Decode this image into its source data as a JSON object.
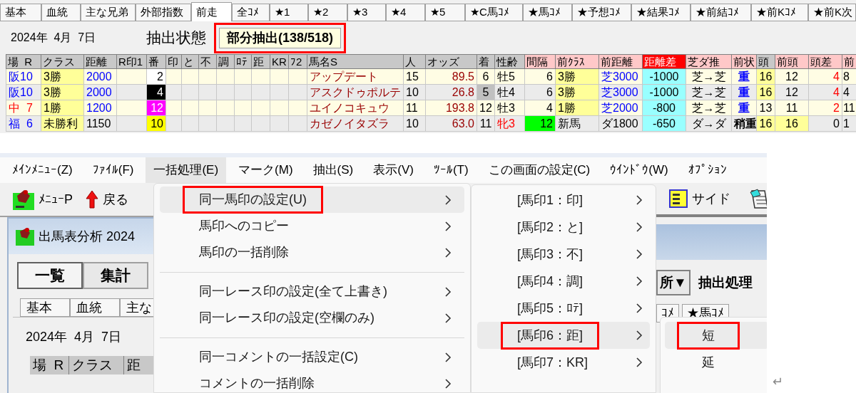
{
  "top_panel": {
    "tabs": [
      {
        "label": "基本",
        "selected": false
      },
      {
        "label": "血統",
        "selected": false
      },
      {
        "label": "主な兄弟",
        "selected": false
      },
      {
        "label": "外部指数",
        "selected": false
      },
      {
        "label": "前走",
        "selected": true
      },
      {
        "label": "全ｺﾒ",
        "selected": false
      },
      {
        "label": "★1",
        "selected": false
      },
      {
        "label": "★2",
        "selected": false
      },
      {
        "label": "★3",
        "selected": false
      },
      {
        "label": "★4",
        "selected": false
      },
      {
        "label": "★5",
        "selected": false
      },
      {
        "label": "★C馬ｺﾒ",
        "selected": false
      },
      {
        "label": "★馬ｺﾒ",
        "selected": false
      },
      {
        "label": "★予想ｺﾒ",
        "selected": false
      },
      {
        "label": "★結果ｺﾒ",
        "selected": false
      },
      {
        "label": "★前結ｺﾒ",
        "selected": false
      },
      {
        "label": "★前Kｺﾒ",
        "selected": false
      },
      {
        "label": "★前K次",
        "selected": false
      }
    ],
    "date": "2024年  4月  7日",
    "extraction_label": "抽出状態",
    "extraction_status": {
      "text": "部分抽出(138/518)",
      "boxed": true
    },
    "table": {
      "columns": [
        {
          "label": "場  R",
          "kind": "plain"
        },
        {
          "label": "クラス",
          "kind": "plain"
        },
        {
          "label": "距離",
          "kind": "plain"
        },
        {
          "label": "R印1",
          "kind": "plain"
        },
        {
          "label": "番",
          "kind": "plain"
        },
        {
          "label": "印",
          "kind": "plain"
        },
        {
          "label": "と",
          "kind": "plain"
        },
        {
          "label": "不",
          "kind": "plain"
        },
        {
          "label": "調",
          "kind": "plain"
        },
        {
          "label": "ﾛﾃ",
          "kind": "plain"
        },
        {
          "label": "距",
          "kind": "plain"
        },
        {
          "label": "KR",
          "kind": "plain"
        },
        {
          "label": "ﾌ2",
          "kind": "plain"
        },
        {
          "label": "馬名S",
          "kind": "plain"
        },
        {
          "label": "人",
          "kind": "plain"
        },
        {
          "label": "オッズ",
          "kind": "plain"
        },
        {
          "label": "着",
          "kind": "plain"
        },
        {
          "label": "性齢",
          "kind": "plain"
        },
        {
          "label": "間隔",
          "kind": "previous"
        },
        {
          "label": "前ｸﾗｽ",
          "kind": "previous"
        },
        {
          "label": "前距離",
          "kind": "previous"
        },
        {
          "label": "距離差",
          "kind": "key"
        },
        {
          "label": "芝ダ推",
          "kind": "previous"
        },
        {
          "label": "前状",
          "kind": "previous"
        },
        {
          "label": "頭",
          "kind": "plain"
        },
        {
          "label": "前頭",
          "kind": "previous"
        },
        {
          "label": "頭差",
          "kind": "previous"
        },
        {
          "label": "前",
          "kind": "previous"
        }
      ],
      "rows": [
        {
          "cells": [
            {
              "text": "阪10",
              "color": "#0000ff"
            },
            {
              "text": "3勝",
              "fill": {
                "color": "#ffff99"
              }
            },
            {
              "text": "2000",
              "color": "#0000ff"
            },
            null,
            {
              "text": "2",
              "fill": {
                "color": "#ffffff"
              }
            },
            null,
            null,
            null,
            null,
            null,
            null,
            null,
            null,
            {
              "text": "アップデート",
              "color": "#990000"
            },
            {
              "text": "15"
            },
            {
              "text": "89.5",
              "color": "#990000"
            },
            {
              "text": "6"
            },
            {
              "text": "牡5"
            },
            {
              "text": "6"
            },
            {
              "text": "3勝",
              "fill": {
                "color": "#ffff99"
              }
            },
            {
              "text": "芝3000",
              "color": "#0000ff"
            },
            {
              "text": "-1000",
              "fill": {
                "color": "#99ffff"
              }
            },
            {
              "text": "芝→芝"
            },
            {
              "text": "重",
              "color": "#0000ff"
            },
            {
              "text": "16",
              "fill": {
                "color": "#ffff99"
              }
            },
            {
              "text": "12"
            },
            {
              "text": "4",
              "color": "#ff0000"
            },
            {
              "text": "8"
            }
          ]
        },
        {
          "cells": [
            {
              "text": "阪10",
              "color": "#0000ff"
            },
            {
              "text": "3勝",
              "fill": {
                "color": "#ffff99"
              }
            },
            {
              "text": "2000",
              "color": "#0000ff"
            },
            null,
            {
              "text": "4",
              "color": "#ffffff",
              "fill": {
                "color": "#000000"
              }
            },
            null,
            null,
            null,
            null,
            null,
            null,
            null,
            null,
            {
              "text": "アスクドゥポルテ",
              "color": "#990000"
            },
            {
              "text": "10"
            },
            {
              "text": "26.8",
              "color": "#990000"
            },
            {
              "text": "5",
              "fill": {
                "color": "#c0c0c0"
              }
            },
            {
              "text": "牡4"
            },
            {
              "text": "6"
            },
            {
              "text": "3勝",
              "fill": {
                "color": "#ffff99"
              }
            },
            {
              "text": "芝3000",
              "color": "#0000ff"
            },
            {
              "text": "-1000",
              "fill": {
                "color": "#99ffff"
              }
            },
            {
              "text": "芝→芝"
            },
            {
              "text": "重",
              "color": "#0000ff"
            },
            {
              "text": "16",
              "fill": {
                "color": "#ffff99"
              }
            },
            {
              "text": "12"
            },
            {
              "text": "4",
              "color": "#ff0000"
            },
            {
              "text": "4"
            }
          ]
        },
        {
          "cells": [
            {
              "text": "中  7",
              "color": "#ff0000"
            },
            {
              "text": "1勝",
              "fill": {
                "color": "#ffff99"
              }
            },
            {
              "text": "1200",
              "color": "#0000ff"
            },
            null,
            {
              "text": "12",
              "color": "#ffffff",
              "fill": {
                "color": "#ff00ff"
              }
            },
            null,
            null,
            null,
            null,
            null,
            null,
            null,
            null,
            {
              "text": "ユイノコキュウ",
              "color": "#990000"
            },
            {
              "text": "11"
            },
            {
              "text": "193.8",
              "color": "#990000"
            },
            {
              "text": "12"
            },
            {
              "text": "牡3"
            },
            {
              "text": "4"
            },
            {
              "text": "1勝",
              "fill": {
                "color": "#ffff99"
              }
            },
            {
              "text": "芝2000",
              "color": "#0000ff"
            },
            {
              "text": "-800",
              "fill": {
                "color": "#99ffff"
              }
            },
            {
              "text": "芝→芝"
            },
            {
              "text": "重",
              "color": "#0000ff"
            },
            {
              "text": "13"
            },
            {
              "text": "11"
            },
            {
              "text": "2",
              "color": "#ff0000"
            },
            {
              "text": "11"
            }
          ]
        },
        {
          "cells": [
            {
              "text": "福  6",
              "color": "#0000ff"
            },
            {
              "text": "未勝利",
              "fill": {
                "color": "#ffff99"
              }
            },
            {
              "text": "1150"
            },
            null,
            {
              "text": "10",
              "fill": {
                "color": "#ffff00"
              }
            },
            null,
            null,
            null,
            null,
            null,
            null,
            null,
            null,
            {
              "text": "カゼノイタズラ",
              "color": "#990000"
            },
            {
              "text": "10"
            },
            {
              "text": "63.0",
              "color": "#990000"
            },
            {
              "text": "11"
            },
            {
              "text": "牝3",
              "color": "#ff0000"
            },
            {
              "text": "12",
              "fill": {
                "color": "#00ff00"
              }
            },
            {
              "text": "新馬"
            },
            {
              "text": "ダ1800"
            },
            {
              "text": "-650",
              "fill": {
                "color": "#99ffff"
              }
            },
            {
              "text": "ダ→ダ"
            },
            {
              "text": "稍重"
            },
            {
              "text": "16",
              "fill": {
                "color": "#ffff99"
              }
            },
            {
              "text": "16",
              "fill": {
                "color": "#ffff99"
              }
            },
            {
              "text": "0"
            },
            {
              "text": "1"
            }
          ]
        }
      ]
    }
  },
  "app": {
    "menu_bar": [
      {
        "label": "ﾒｲﾝﾒﾆｭｰ(Z)",
        "selected": false
      },
      {
        "label": "ﾌｧｲﾙ(F)",
        "selected": false
      },
      {
        "label": "一括処理(E)",
        "selected": true
      },
      {
        "label": "マーク(M)",
        "selected": false
      },
      {
        "label": "抽出(S)",
        "selected": false
      },
      {
        "label": "表示(V)",
        "selected": false
      },
      {
        "label": "ﾂｰﾙ(T)",
        "selected": false
      },
      {
        "label": "この画面の設定(C)",
        "selected": false
      },
      {
        "label": "ｳｲﾝﾄﾞｳ(W)",
        "selected": false
      },
      {
        "label": "ｵﾌﾟｼｮﾝ",
        "selected": false
      }
    ],
    "toolbar_left": [
      {
        "label": "ﾒﾆｭｰP"
      },
      {
        "label": "戻る"
      }
    ],
    "toolbar_right": [
      {
        "label": "サイド"
      }
    ],
    "child_window": {
      "title": "出馬表分析 2024",
      "buttons": [
        {
          "label": "一覧",
          "selected": true
        },
        {
          "label": "集計",
          "selected": false
        }
      ],
      "tabs": [
        "基本",
        "血統",
        "主な"
      ],
      "date": "2024年  4月  7日",
      "columns": [
        "場  R",
        "クラス",
        "距"
      ],
      "right_buttons": [
        "所▼",
        "抽出処理"
      ],
      "right_tabs": [
        "ｺﾒ",
        "★馬ｺﾒ"
      ]
    },
    "menus": [
      {
        "items": [
          {
            "kind": "item",
            "label": "同一馬印の設定(U)",
            "selected": true,
            "boxed": true
          },
          {
            "kind": "item",
            "label": "馬印へのコピー",
            "selected": false,
            "boxed": false
          },
          {
            "kind": "item",
            "label": "馬印の一括削除",
            "selected": false,
            "boxed": false
          },
          {
            "kind": "separator"
          },
          {
            "kind": "item",
            "label": "同一レース印の設定(全て上書き)",
            "selected": false,
            "boxed": false
          },
          {
            "kind": "item",
            "label": "同一レース印の設定(空欄のみ)",
            "selected": false,
            "boxed": false
          },
          {
            "kind": "separator"
          },
          {
            "kind": "item",
            "label": "同一コメントの一括設定(C)",
            "selected": false,
            "boxed": false
          },
          {
            "kind": "item",
            "label": "コメントの一括削除",
            "selected": false,
            "boxed": false
          }
        ]
      },
      {
        "items": [
          {
            "kind": "item",
            "label": "[馬印1：印]",
            "selected": false,
            "boxed": false
          },
          {
            "kind": "item",
            "label": "[馬印2：と]",
            "selected": false,
            "boxed": false
          },
          {
            "kind": "item",
            "label": "[馬印3：不]",
            "selected": false,
            "boxed": false
          },
          {
            "kind": "item",
            "label": "[馬印4：調]",
            "selected": false,
            "boxed": false
          },
          {
            "kind": "item",
            "label": "[馬印5：ﾛﾃ]",
            "selected": false,
            "boxed": false
          },
          {
            "kind": "item",
            "label": "[馬印6：距]",
            "selected": true,
            "boxed": true
          },
          {
            "kind": "item",
            "label": "[馬印7：KR]",
            "selected": false,
            "boxed": false
          }
        ]
      },
      {
        "items": [
          {
            "kind": "leaf",
            "label": "短",
            "selected": true,
            "boxed": true
          },
          {
            "kind": "leaf",
            "label": "延",
            "selected": false,
            "boxed": false
          }
        ]
      }
    ],
    "return_mark": "↵"
  }
}
